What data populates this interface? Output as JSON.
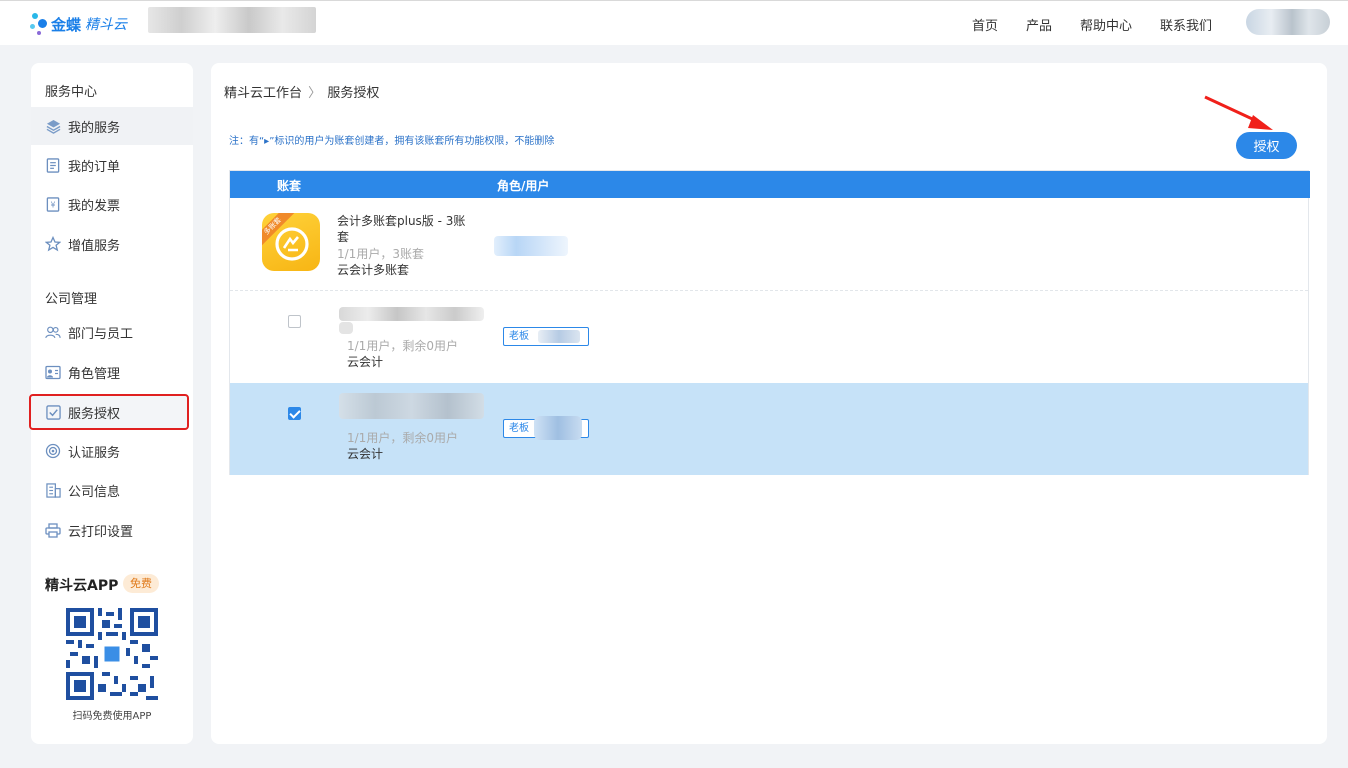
{
  "header": {
    "logo_brand": "金蝶",
    "logo_sub": "精斗云",
    "nav": [
      "首页",
      "产品",
      "帮助中心",
      "联系我们"
    ]
  },
  "sidebar": {
    "section_service": "服务中心",
    "service_items": [
      {
        "label": "我的服务",
        "icon": "layers-icon"
      },
      {
        "label": "我的订单",
        "icon": "order-icon"
      },
      {
        "label": "我的发票",
        "icon": "invoice-icon"
      },
      {
        "label": "增值服务",
        "icon": "star-icon"
      }
    ],
    "section_company": "公司管理",
    "company_items": [
      {
        "label": "部门与员工",
        "icon": "users-icon"
      },
      {
        "label": "角色管理",
        "icon": "role-icon"
      },
      {
        "label": "服务授权",
        "icon": "check-square-icon"
      },
      {
        "label": "认证服务",
        "icon": "certify-icon"
      },
      {
        "label": "公司信息",
        "icon": "building-icon"
      },
      {
        "label": "云打印设置",
        "icon": "printer-icon"
      }
    ],
    "app_title": "精斗云APP",
    "app_badge": "免费",
    "qr_caption": "扫码免费使用APP"
  },
  "main": {
    "breadcrumb_root": "精斗云工作台",
    "breadcrumb_current": "服务授权",
    "note": "注：有“▸”标识的用户为账套创建者，拥有该账套所有功能权限，不能删除",
    "auth_button": "授权",
    "table": {
      "col_account": "账套",
      "col_role_user": "角色/用户",
      "rows": [
        {
          "title": "会计多账套plus版 - 3账套",
          "sub": "1/1用户，3账套",
          "type": "云会计多账套",
          "icon_ribbon": "多账套"
        },
        {
          "sub": "1/1用户，剩余0用户",
          "type": "云会计",
          "role": "老板",
          "checked": false
        },
        {
          "sub": "1/1用户，剩余0用户",
          "type": "云会计",
          "role": "老板",
          "checked": true
        }
      ]
    }
  },
  "colors": {
    "primary": "#2c88e8",
    "highlight_border": "#e02020",
    "selected_row": "#c6e2f8"
  }
}
